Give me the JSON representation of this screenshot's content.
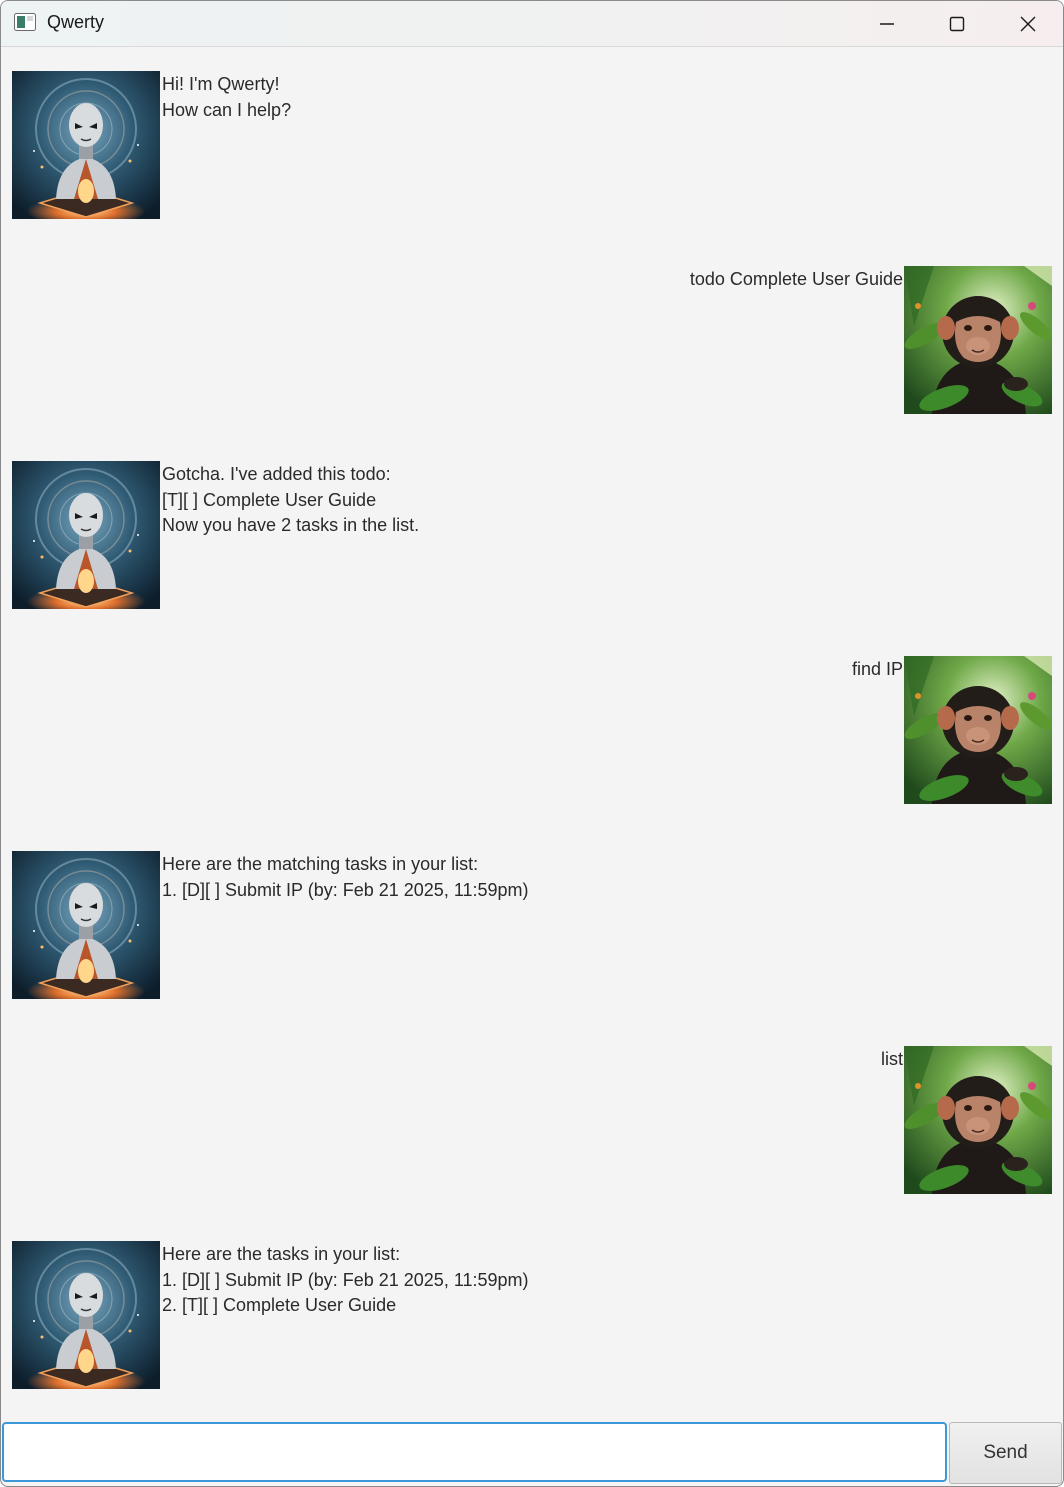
{
  "window": {
    "title": "Qwerty",
    "controls": [
      "minimize",
      "maximize",
      "close"
    ]
  },
  "dialogs": [
    {
      "speaker": "bot",
      "avatar": "robot-avatar",
      "text": "Hi! I'm Qwerty!\nHow can I help?"
    },
    {
      "speaker": "user",
      "avatar": "chimp-avatar",
      "text": "todo Complete User Guide"
    },
    {
      "speaker": "bot",
      "avatar": "robot-avatar",
      "text": "Gotcha. I've added this todo:\n[T][ ] Complete User Guide\nNow you have 2 tasks in the list."
    },
    {
      "speaker": "user",
      "avatar": "chimp-avatar",
      "text": "find IP"
    },
    {
      "speaker": "bot",
      "avatar": "robot-avatar",
      "text": "Here are the matching tasks in your list:\n1. [D][ ] Submit IP (by: Feb 21 2025, 11:59pm)"
    },
    {
      "speaker": "user",
      "avatar": "chimp-avatar",
      "text": "list"
    },
    {
      "speaker": "bot",
      "avatar": "robot-avatar",
      "text": "Here are the tasks in your list:\n1. [D][ ] Submit IP (by: Feb 21 2025, 11:59pm)\n2. [T][ ] Complete User Guide"
    }
  ],
  "input": {
    "value": "",
    "send_label": "Send"
  },
  "colors": {
    "chat_background": "#f4f4f4",
    "input_focus_border": "#3c98d8"
  }
}
